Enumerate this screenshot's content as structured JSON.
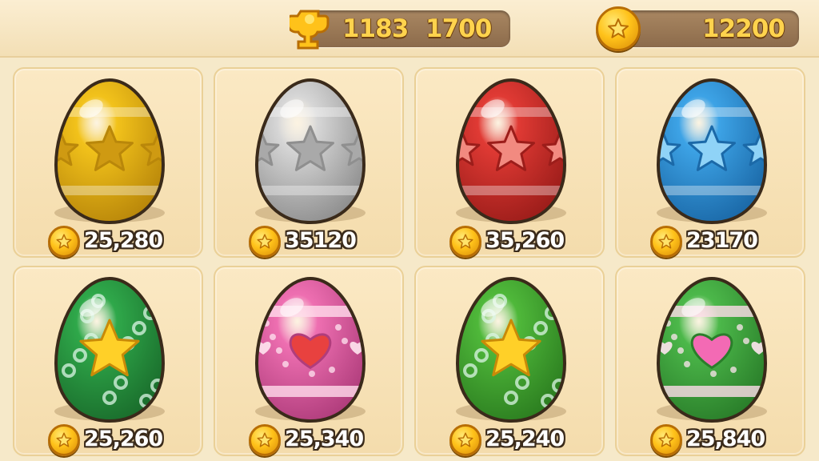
{
  "header": {
    "trophy_icon": "trophy-icon",
    "progress_current": "1183",
    "progress_target": "1700",
    "coin_icon": "coin-icon",
    "coins_total": "12200",
    "colors": {
      "pill": "#9a7854",
      "value": "#ffd34d"
    }
  },
  "eggs": [
    {
      "name": "gold-star-egg",
      "price": "25,280",
      "base": "#f2c21b",
      "dark": "#b9870a",
      "pattern": "stars",
      "accent": "#cf9a12"
    },
    {
      "name": "silver-star-egg",
      "price": "35120",
      "base": "#d6d6d6",
      "dark": "#8f8f8f",
      "pattern": "stars",
      "accent": "#a9a9a9"
    },
    {
      "name": "red-star-egg",
      "price": "35,260",
      "base": "#e03a34",
      "dark": "#9c1d1a",
      "pattern": "stars",
      "accent": "#f28a80"
    },
    {
      "name": "blue-star-egg",
      "price": "23170",
      "base": "#3da3e6",
      "dark": "#1b69a8",
      "pattern": "stars",
      "accent": "#8fd3f7"
    },
    {
      "name": "green-star-egg",
      "price": "25,260",
      "base": "#2fa84a",
      "dark": "#1a6d2c",
      "pattern": "gold-star",
      "accent": "#ffd028"
    },
    {
      "name": "pink-heart-egg",
      "price": "25,340",
      "base": "#ee6fb1",
      "dark": "#b03d7c",
      "pattern": "heart",
      "accent": "#e8413f"
    },
    {
      "name": "lime-star-egg",
      "price": "25,240",
      "base": "#4fb83a",
      "dark": "#2c7e20",
      "pattern": "gold-star",
      "accent": "#ffd028"
    },
    {
      "name": "green-heart-egg",
      "price": "25,840",
      "base": "#4cb84a",
      "dark": "#2a7e2a",
      "pattern": "heart",
      "accent": "#f36ab4"
    }
  ]
}
